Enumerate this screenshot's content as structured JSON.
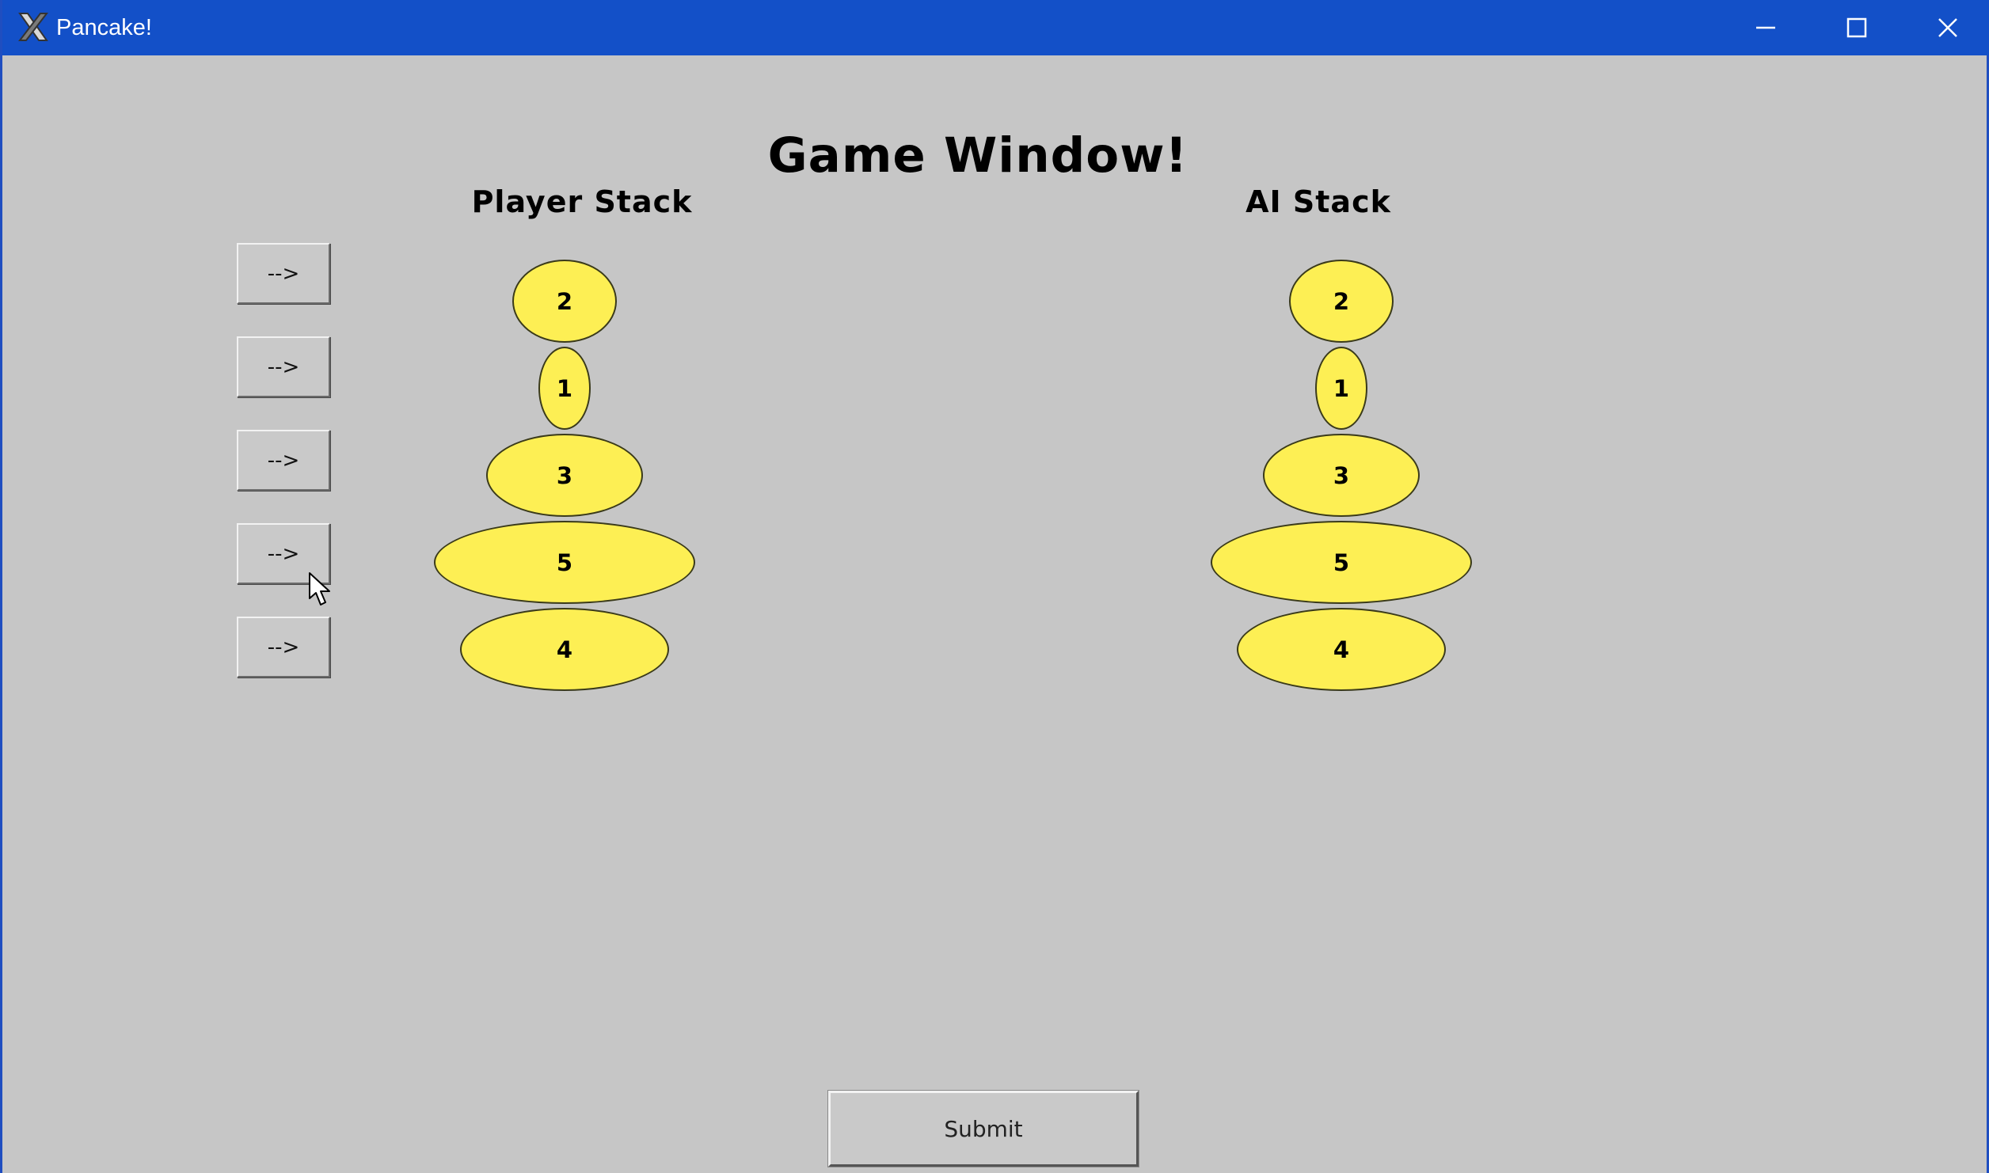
{
  "window": {
    "title": "Pancake!",
    "app_icon": "x11-icon",
    "controls": [
      "minimize-icon",
      "maximize-icon",
      "close-icon"
    ],
    "titlebar_color": "#1350c8",
    "background_color": "#c6c6c6"
  },
  "game": {
    "title": "Game Window!",
    "player_label": "Player Stack",
    "ai_label": "AI Stack"
  },
  "flip_buttons": [
    "-->",
    "-->",
    "-->",
    "-->",
    "-->"
  ],
  "player_stack": [
    2,
    1,
    3,
    5,
    4
  ],
  "ai_stack": [
    2,
    1,
    3,
    5,
    4
  ],
  "pancake_color": "#fdef54",
  "submit_label": "Submit"
}
